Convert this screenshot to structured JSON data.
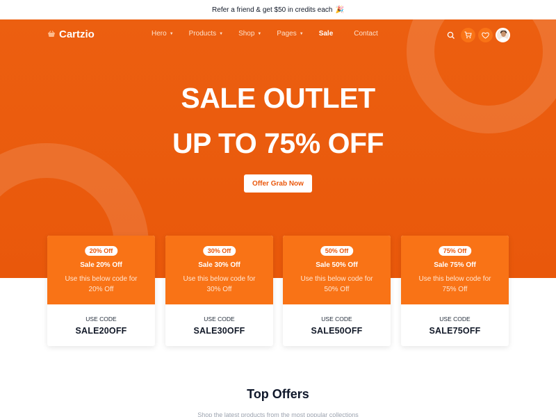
{
  "topbar": {
    "text": "Refer a friend & get $50 in credits each",
    "emoji": "🎉"
  },
  "brand": {
    "name": "Cartzio"
  },
  "nav": {
    "items": [
      {
        "label": "Hero",
        "has_caret": true
      },
      {
        "label": "Products",
        "has_caret": true
      },
      {
        "label": "Shop",
        "has_caret": true
      },
      {
        "label": "Pages",
        "has_caret": true
      },
      {
        "label": "Sale",
        "has_caret": false,
        "active": true
      },
      {
        "label": "Contact",
        "has_caret": false
      }
    ],
    "actions": [
      "search-icon",
      "cart-icon",
      "heart-icon",
      "avatar"
    ]
  },
  "hero": {
    "line1": "SALE OUTLET",
    "line2": "UP TO 75% OFF",
    "cta": "Offer Grab Now"
  },
  "coupons": [
    {
      "badge": "20% Off",
      "title": "Sale 20% Off",
      "desc": "Use this below code for 20% Off",
      "use_label": "USE CODE",
      "code": "SALE20OFF"
    },
    {
      "badge": "30% Off",
      "title": "Sale 30% Off",
      "desc": "Use this below code for 30% Off",
      "use_label": "USE CODE",
      "code": "SALE30OFF"
    },
    {
      "badge": "50% Off",
      "title": "Sale 50% Off",
      "desc": "Use this below code for 50% Off",
      "use_label": "USE CODE",
      "code": "SALE50OFF"
    },
    {
      "badge": "75% Off",
      "title": "Sale 75% Off",
      "desc": "Use this below code for 75% Off",
      "use_label": "USE CODE",
      "code": "SALE75OFF"
    }
  ],
  "section": {
    "title": "Top Offers",
    "subtitle": "Shop the latest products from the most popular collections"
  },
  "colors": {
    "brand": "#ea580c",
    "card_accent": "#f97316",
    "text_dark": "#111827"
  }
}
